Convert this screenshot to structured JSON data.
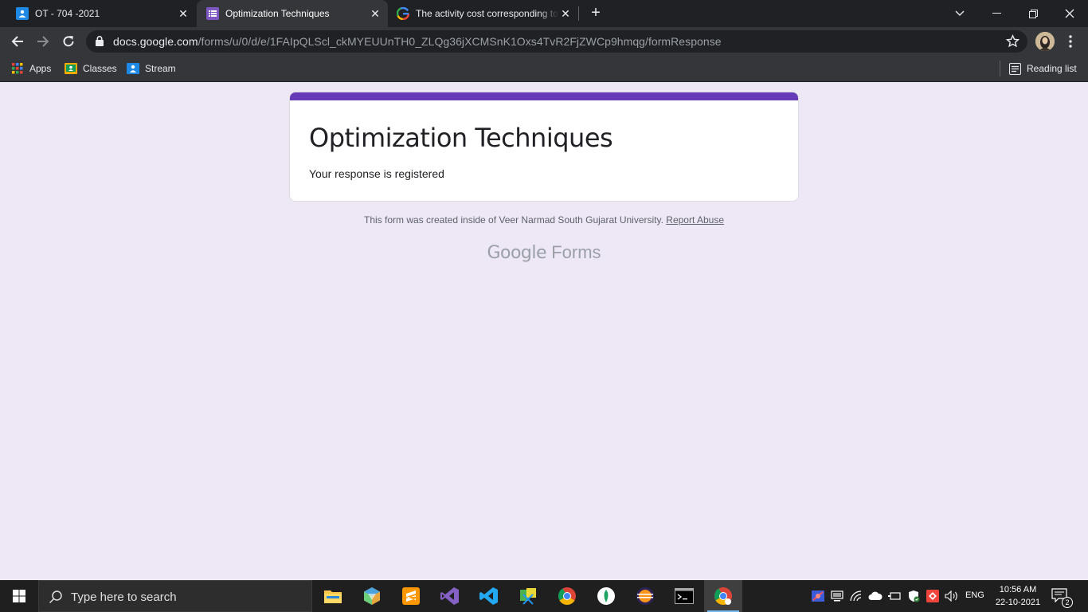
{
  "browser": {
    "tabs": [
      {
        "title": "OT - 704 -2021",
        "icon": "classroom-icon",
        "active": false
      },
      {
        "title": "Optimization Techniques",
        "icon": "forms-icon",
        "active": true
      },
      {
        "title": "The activity cost corresponding to",
        "icon": "google-icon",
        "active": false
      }
    ],
    "new_tab_label": "+",
    "address": {
      "host": "docs.google.com",
      "path": "/forms/u/0/d/e/1FAIpQLScl_ckMYEUUnTH0_ZLQg36jXCMSnK1Oxs4TvR2FjZWCp9hmqg/formResponse"
    },
    "bookmarks": [
      {
        "label": "Apps",
        "icon": "apps-grid-icon"
      },
      {
        "label": "Classes",
        "icon": "classroom-icon"
      },
      {
        "label": "Stream",
        "icon": "classroom-icon"
      }
    ],
    "reading_list_label": "Reading list"
  },
  "form": {
    "title": "Optimization Techniques",
    "message": "Your response is registered",
    "footer_text": "This form was created inside of Veer Narmad South Gujarat University.",
    "report_link": "Report Abuse",
    "brand_google": "Google",
    "brand_forms": "Forms",
    "accent_color": "#673ab7",
    "background_color": "#ede7f6"
  },
  "taskbar": {
    "search_placeholder": "Type here to search",
    "apps": [
      "file-explorer",
      "3d-app",
      "sublime-text",
      "visual-studio",
      "vs-code",
      "snipping-tool",
      "chrome",
      "node-app",
      "eclipse",
      "terminal",
      "chrome-active"
    ],
    "language": "ENG",
    "time": "10:56 AM",
    "date": "22-10-2021",
    "notification_count": "2"
  }
}
